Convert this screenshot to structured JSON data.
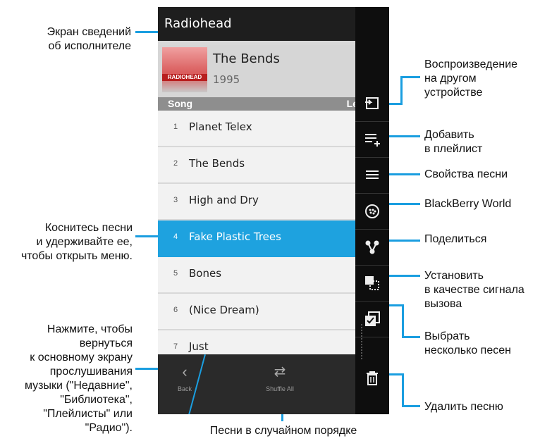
{
  "app": {
    "title": "Radiohead",
    "album": {
      "name": "The Bends",
      "year": "1995",
      "cover_text": "RADIOHEAD"
    },
    "columns": {
      "song": "Song",
      "length": "Le"
    },
    "songs": [
      {
        "num": "1",
        "title": "Planet Telex"
      },
      {
        "num": "2",
        "title": "The Bends"
      },
      {
        "num": "3",
        "title": "High and Dry"
      },
      {
        "num": "4",
        "title": "Fake Plastic Trees"
      },
      {
        "num": "5",
        "title": "Bones"
      },
      {
        "num": "6",
        "title": "(Nice Dream)"
      },
      {
        "num": "7",
        "title": "Just"
      }
    ],
    "selected_index": 3,
    "bottom": {
      "back_label": "Back",
      "shuffle_label": "Shuffle All"
    },
    "action_icons": [
      "play-on-device-icon",
      "add-to-playlist-icon",
      "song-properties-icon",
      "blackberry-world-icon",
      "share-icon",
      "set-ringtone-icon",
      "select-multiple-icon",
      "delete-icon"
    ]
  },
  "annotations": {
    "artist_screen": "Экран сведений\nоб исполнителе",
    "touch_hold": "Коснитесь песни\nи удерживайте ее,\nчтобы открыть меню.",
    "back_info": "Нажмите, чтобы\nвернуться\nк основному экрану\nпрослушивания\nмузыки (\"Недавние\",\n\"Библиотека\",\n\"Плейлисты\" или\n\"Радио\").",
    "shuffle": "Песни в случайном порядке",
    "play_other": "Воспроизведение\nна другом\nустройстве",
    "add_playlist": "Добавить\nв плейлист",
    "song_props": "Свойства песни",
    "bb_world": "BlackBerry World",
    "share": "Поделиться",
    "ringtone": "Установить\nв качестве сигнала\nвызова",
    "select_multiple": "Выбрать\nнесколько песен",
    "delete": "Удалить песню"
  },
  "colors": {
    "accent": "#1a9ee0",
    "selected_row": "#1ea2df"
  }
}
